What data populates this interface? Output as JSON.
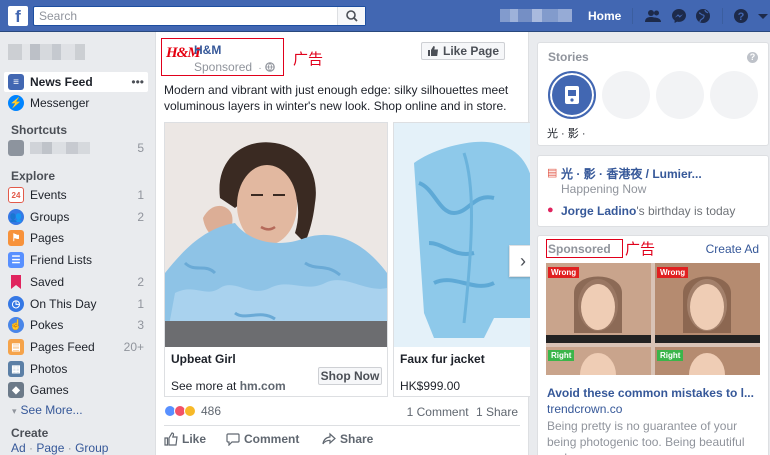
{
  "topbar": {
    "search_placeholder": "Search",
    "home_label": "Home",
    "brand_color": "#4267b2"
  },
  "left_nav": {
    "main_items": [
      {
        "label": "News Feed",
        "more": "•••"
      },
      {
        "label": "Messenger"
      }
    ],
    "shortcuts_header": "Shortcuts",
    "shortcut_count": "5",
    "explore_header": "Explore",
    "explore_items": [
      {
        "label": "Events",
        "count": "1",
        "icon": "calendar-icon"
      },
      {
        "label": "Groups",
        "count": "2",
        "icon": "groups-icon"
      },
      {
        "label": "Pages",
        "count": "",
        "icon": "flag-icon"
      },
      {
        "label": "Friend Lists",
        "count": "",
        "icon": "friend-list-icon"
      },
      {
        "label": "Saved",
        "count": "2",
        "icon": "bookmark-icon"
      },
      {
        "label": "On This Day",
        "count": "1",
        "icon": "clock-icon"
      },
      {
        "label": "Pokes",
        "count": "3",
        "icon": "poke-icon"
      },
      {
        "label": "Pages Feed",
        "count": "20+",
        "icon": "pages-feed-icon"
      },
      {
        "label": "Photos",
        "count": "",
        "icon": "photos-icon"
      },
      {
        "label": "Games",
        "count": "",
        "icon": "games-icon"
      }
    ],
    "see_more": "See More...",
    "create_header": "Create",
    "create_links": [
      "Ad",
      "Page",
      "Group"
    ]
  },
  "post": {
    "page_name": "H&M",
    "logo_text": "H&M",
    "sponsored": "Sponsored",
    "like_page": "Like Page",
    "annotation": "广告",
    "text": "Modern and vibrant with just enough edge: silky silhouettes meet voluminous layers in winter's new look. Shop online and in store.",
    "cards": [
      {
        "title": "Upbeat Girl",
        "sub_prefix": "See more at ",
        "sub_link": "hm.com",
        "cta": "Shop Now"
      },
      {
        "title": "Faux fur jacket",
        "price": "HK$999.00"
      }
    ],
    "reaction_count": "486",
    "comments": "1 Comment",
    "shares": "1 Share",
    "actions": {
      "like": "Like",
      "comment": "Comment",
      "share": "Share"
    }
  },
  "right": {
    "stories_header": "Stories",
    "story_label": "光 · 影 ·",
    "event_title": "光 · 影 · 香港夜 / Lumier...",
    "event_sub": "Happening Now",
    "birthday_name": "Jorge Ladino",
    "birthday_text": "'s birthday is today",
    "ad": {
      "sponsored": "Sponsored",
      "annotation": "广告",
      "create_ad": "Create Ad",
      "tag_wrong": "Wrong",
      "tag_right": "Right",
      "title": "Avoid these common mistakes to l...",
      "domain": "trendcrown.co",
      "body": "Being pretty is no guarantee of your being photogenic too. Being beautiful and"
    }
  }
}
